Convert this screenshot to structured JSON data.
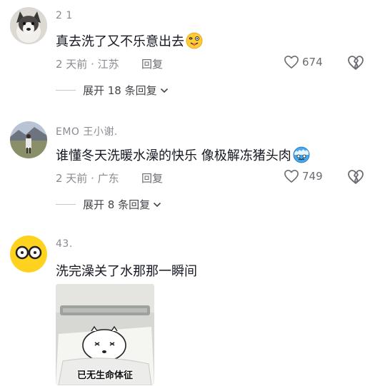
{
  "comments": [
    {
      "username": "2 1",
      "text": "真去洗了又不乐意出去",
      "emoji": "dizzy-tongue-emoji",
      "time": "2 天前",
      "location": "江苏",
      "reply_label": "回复",
      "likes": "674",
      "expand_label": "展开 18 条回复"
    },
    {
      "username": "EMO 王小谢.",
      "text": "谁懂冬天洗暖水澡的快乐 像极解冻猪头肉",
      "emoji": "cold-face-emoji",
      "time": "2 天前",
      "location": "广东",
      "reply_label": "回复",
      "likes": "749",
      "expand_label": "展开 8 条回复"
    },
    {
      "username": "43.",
      "text": "洗完澡关了水那那一瞬间",
      "sticker_caption": "已无生命体征"
    }
  ],
  "separator": "·",
  "colors": {
    "text": "#161823",
    "muted": "#8a8b91",
    "background": "#ffffff"
  }
}
